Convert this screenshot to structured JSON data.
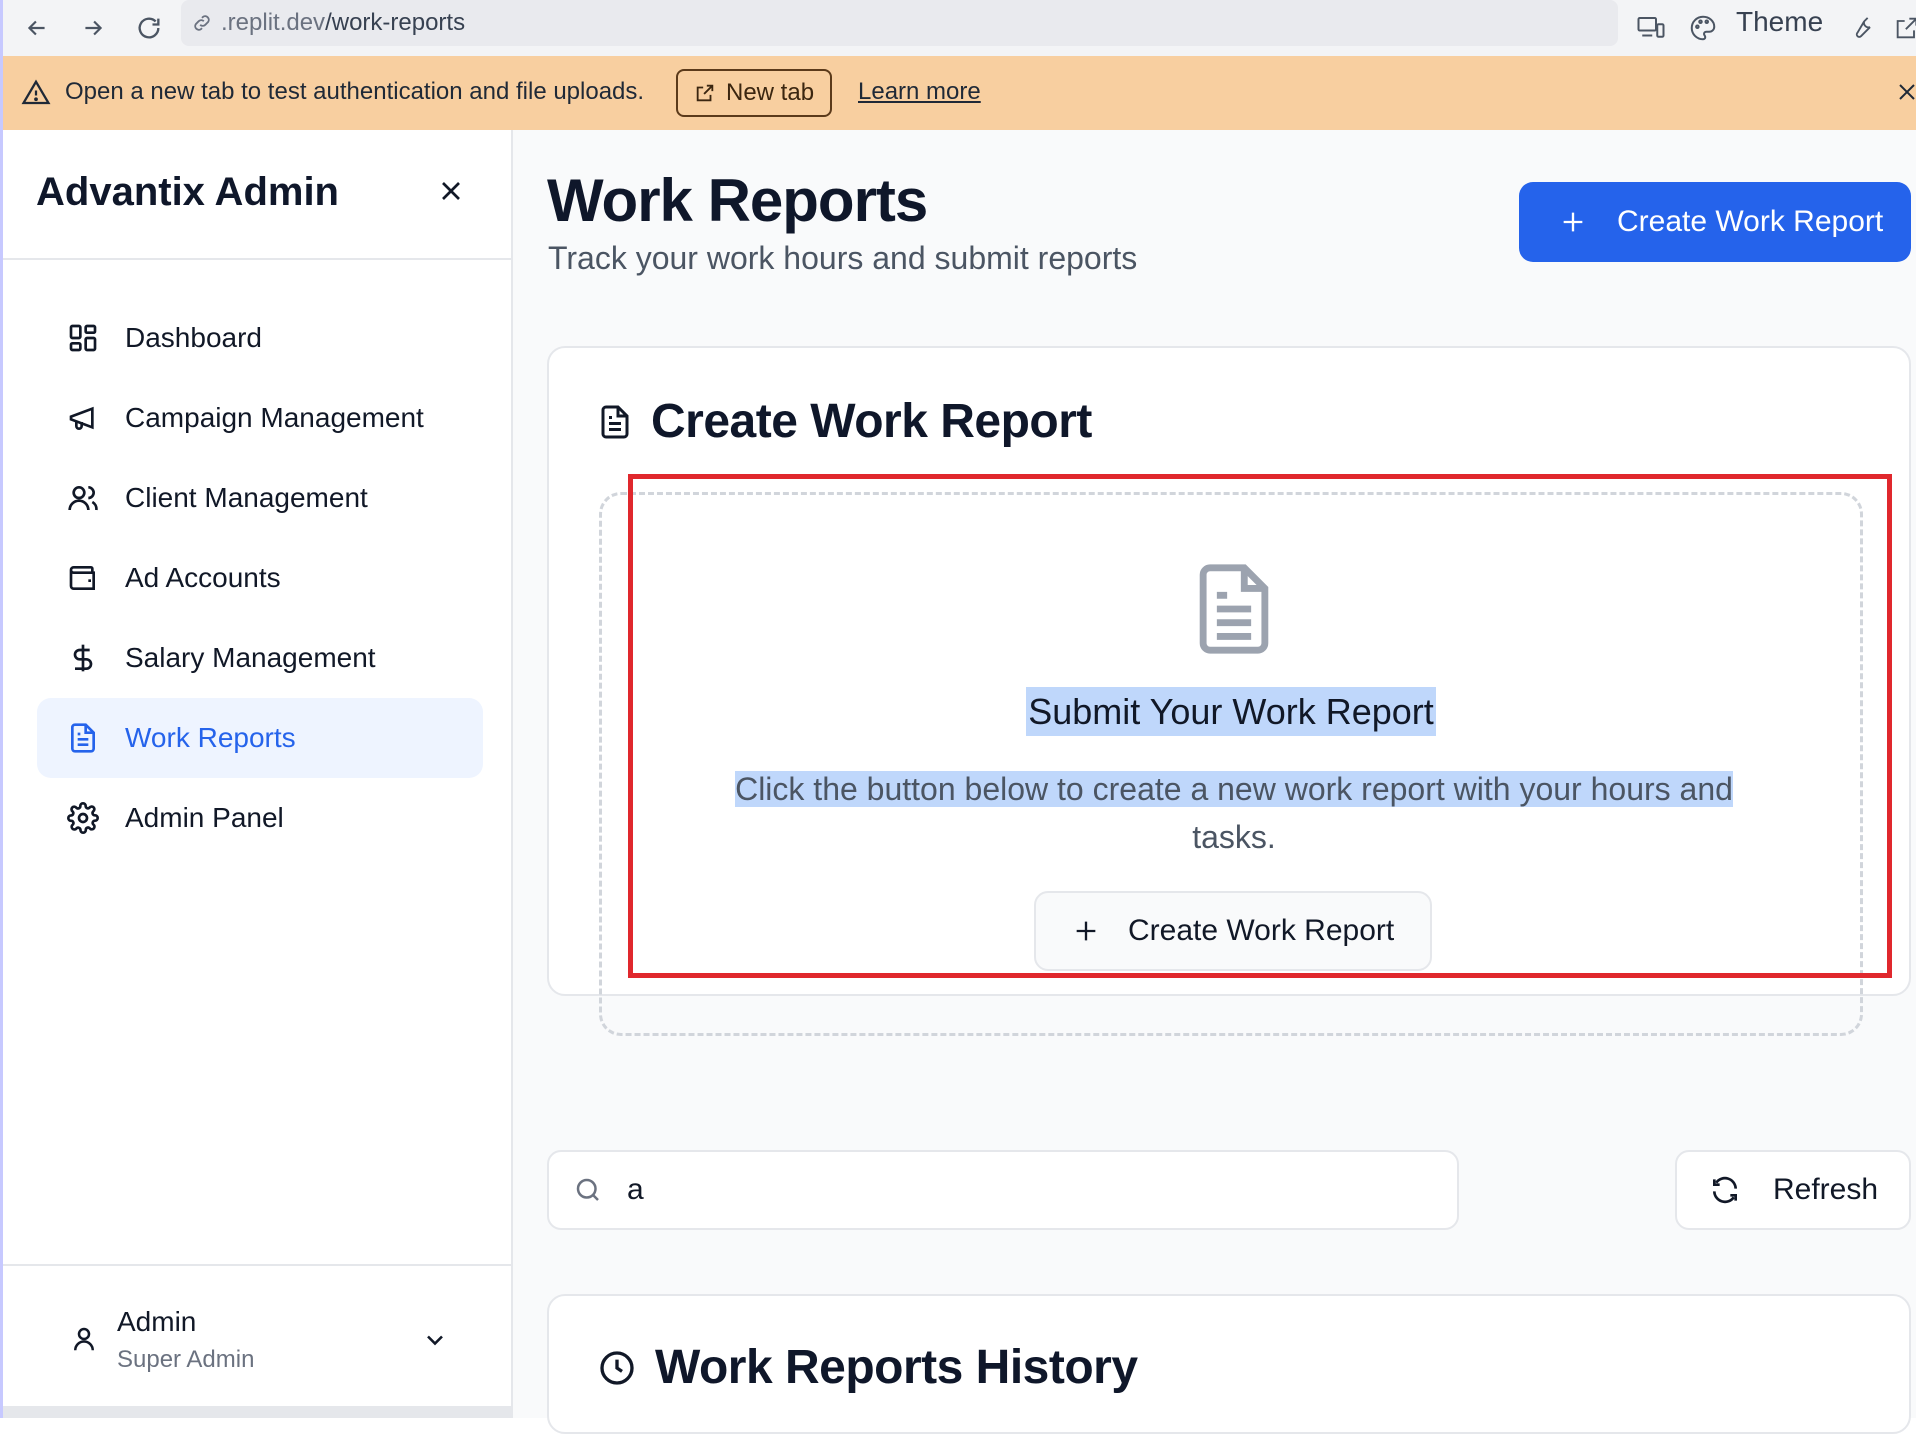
{
  "browser": {
    "url_prefix": ".replit.dev",
    "url_path": "/work-reports",
    "theme_label": "Theme"
  },
  "banner": {
    "message": "Open a new tab to test authentication and file uploads.",
    "new_tab_label": "New tab",
    "learn_more_label": "Learn more"
  },
  "sidebar": {
    "brand": "Advantix Admin",
    "items": [
      {
        "label": "Dashboard",
        "icon": "dashboard-icon"
      },
      {
        "label": "Campaign Management",
        "icon": "megaphone-icon"
      },
      {
        "label": "Client Management",
        "icon": "users-icon"
      },
      {
        "label": "Ad Accounts",
        "icon": "wallet-icon"
      },
      {
        "label": "Salary Management",
        "icon": "dollar-icon"
      },
      {
        "label": "Work Reports",
        "icon": "file-text-icon",
        "active": true
      },
      {
        "label": "Admin Panel",
        "icon": "settings-icon"
      }
    ],
    "user": {
      "name": "Admin",
      "role": "Super Admin"
    }
  },
  "main": {
    "title": "Work Reports",
    "subtitle": "Track your work hours and submit reports",
    "create_button_label": "Create Work Report",
    "create_card": {
      "title": "Create Work Report",
      "empty_title": "Submit Your Work Report",
      "empty_text_line1": "Click the button below to create a new work report with your hours and",
      "empty_text_line2": "tasks.",
      "button_label": "Create Work Report"
    },
    "search": {
      "value": "a"
    },
    "refresh_label": "Refresh",
    "history": {
      "title": "Work Reports History"
    }
  },
  "colors": {
    "accent": "#2563eb",
    "active_bg": "#eef4ff",
    "banner_bg": "#f8cfa0",
    "highlight": "#bfd7fb",
    "annotation_red": "#e0282d"
  }
}
